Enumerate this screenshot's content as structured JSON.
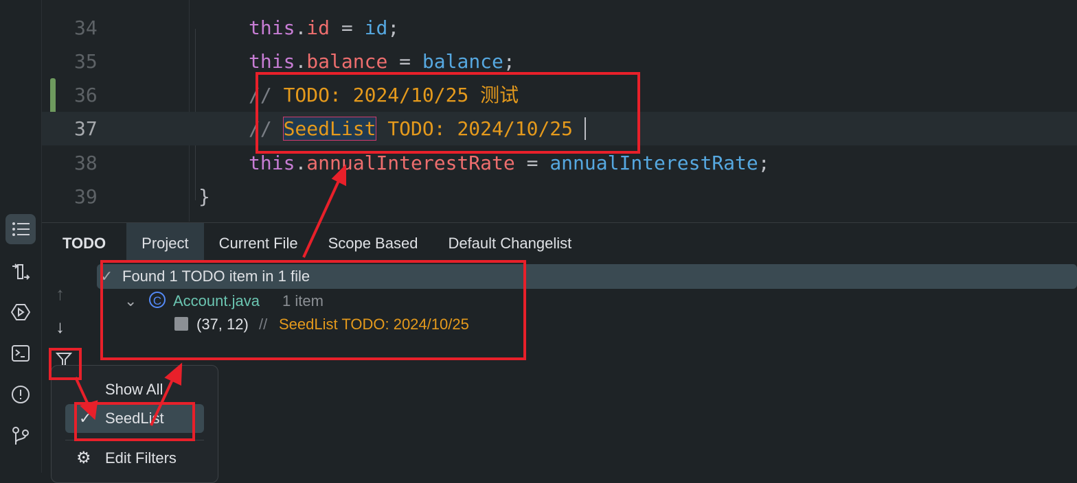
{
  "editor": {
    "lines": [
      {
        "num": "34",
        "this": "this",
        "field": "id",
        "eq": " = ",
        "val": "id",
        "end": ";"
      },
      {
        "num": "35",
        "this": "this",
        "field": "balance",
        "eq": " = ",
        "val": "balance",
        "end": ";"
      },
      {
        "num": "36",
        "comment": "// ",
        "todo": "TODO: 2024/10/25 测试"
      },
      {
        "num": "37",
        "comment": "// ",
        "sel": "SeedList",
        "todo": " TODO: 2024/10/25"
      },
      {
        "num": "38",
        "this": "this",
        "field": "annualInterestRate",
        "eq": " = ",
        "val": "annualInterestRate",
        "end": ";"
      },
      {
        "num": "39",
        "brace": "}"
      }
    ]
  },
  "panel": {
    "title": "TODO",
    "tabs": [
      "Project",
      "Current File",
      "Scope Based",
      "Default Changelist"
    ],
    "summary": "Found 1 TODO item in 1 file",
    "file": {
      "name": "Account.java",
      "count": "1 item"
    },
    "item": {
      "pos": "(37, 12)",
      "comment": "//",
      "text": "SeedList TODO: 2024/10/25"
    }
  },
  "menu": {
    "items": [
      "Show All",
      "SeedList",
      "Edit Filters"
    ]
  },
  "colors": {
    "annotation": "#e8202a",
    "accent": "#3aa6a0"
  }
}
